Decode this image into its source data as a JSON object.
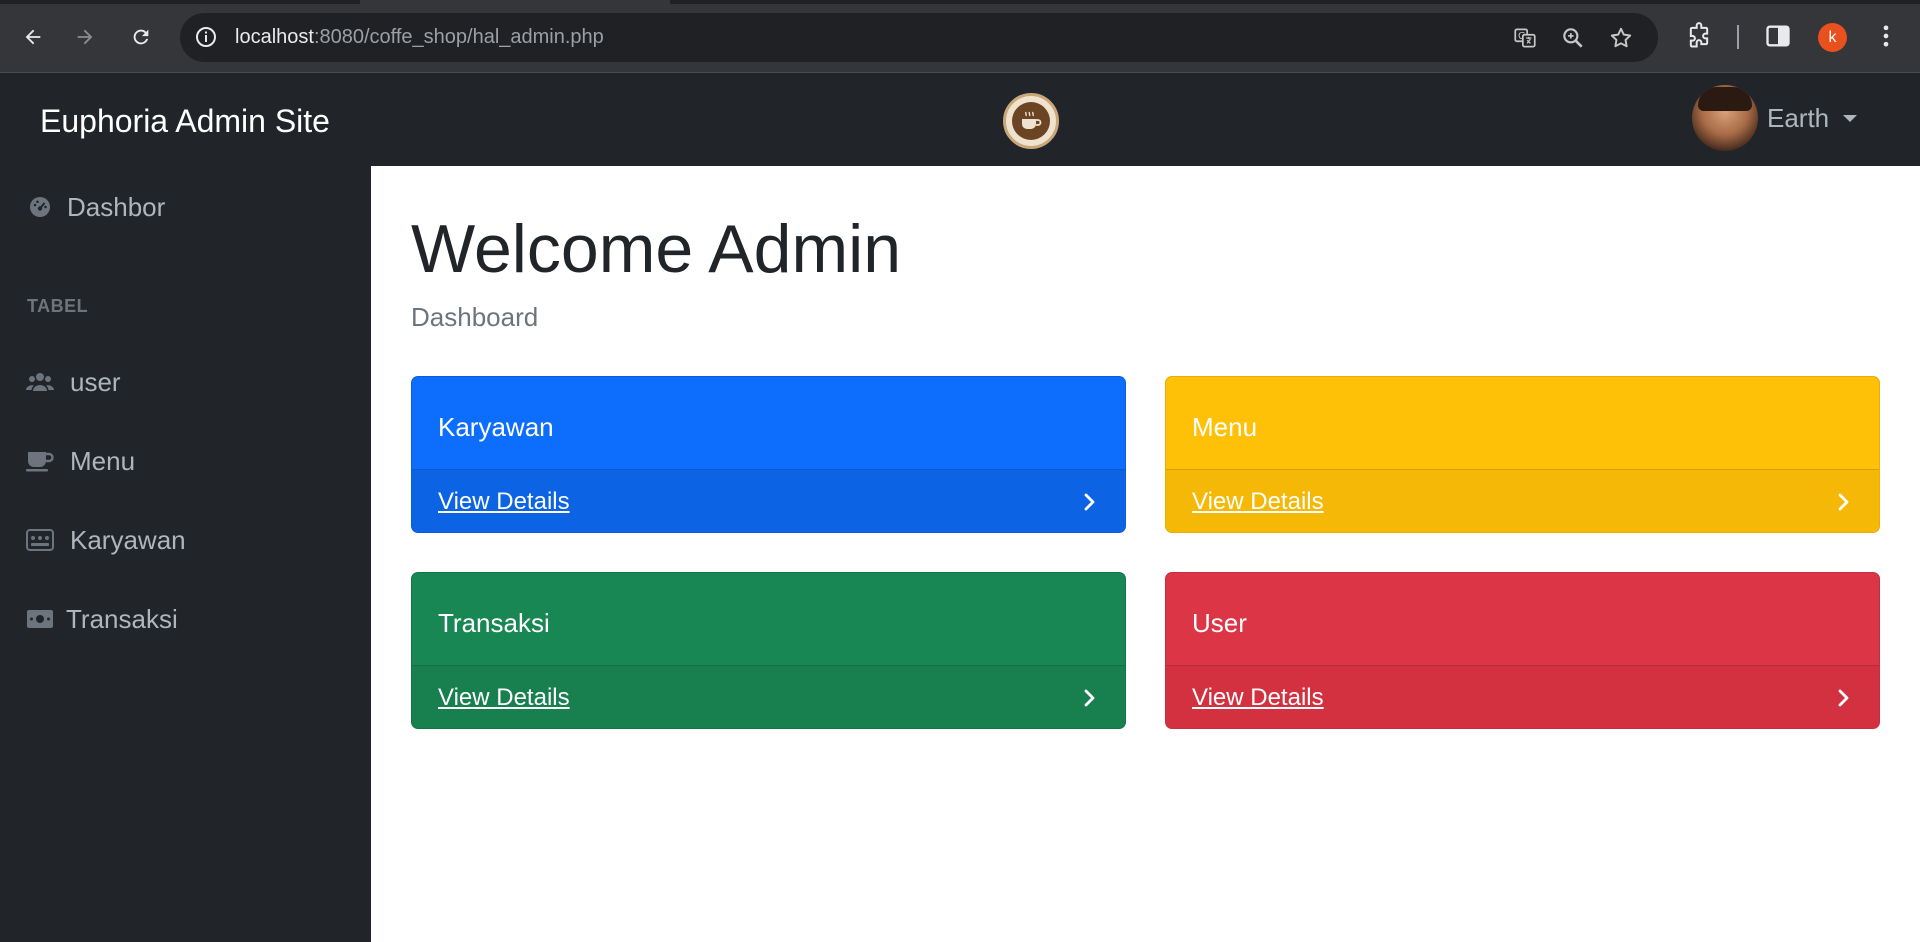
{
  "browser": {
    "url_host": "localhost",
    "url_path": ":8080/coffe_shop/hal_admin.php",
    "profile_initial": "k"
  },
  "navbar": {
    "brand": "Euphoria Admin Site",
    "user_name": "Earth"
  },
  "sidebar": {
    "items": [
      {
        "label": "Dashbor",
        "icon": "dashboard-gauge-icon"
      },
      {
        "label": "user",
        "icon": "users-icon"
      },
      {
        "label": "Menu",
        "icon": "coffee-cup-icon"
      },
      {
        "label": "Karyawan",
        "icon": "id-card-icon"
      },
      {
        "label": "Transaksi",
        "icon": "money-bill-icon"
      }
    ],
    "heading": "TABEL"
  },
  "main": {
    "title": "Welcome Admin",
    "subtitle": "Dashboard",
    "cards": [
      {
        "title": "Karyawan",
        "link": "View Details",
        "color": "#0d6efd"
      },
      {
        "title": "Menu",
        "link": "View Details",
        "color": "#ffc107"
      },
      {
        "title": "Transaksi",
        "link": "View Details",
        "color": "#198754"
      },
      {
        "title": "User",
        "link": "View Details",
        "color": "#dc3545"
      }
    ]
  }
}
